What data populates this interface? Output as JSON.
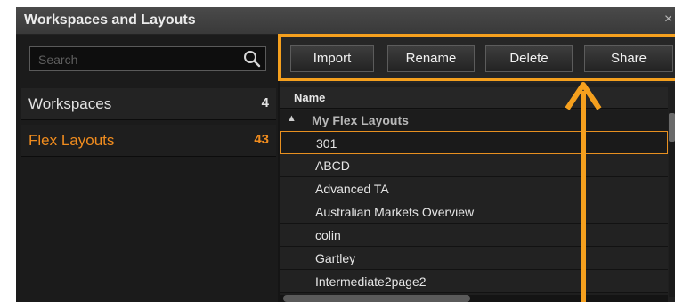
{
  "window": {
    "title": "Workspaces and Layouts",
    "close_glyph": "×"
  },
  "search": {
    "placeholder": "Search",
    "icon": "search-icon"
  },
  "sidebar": {
    "items": [
      {
        "label": "Workspaces",
        "count": "4",
        "active": false
      },
      {
        "label": "Flex Layouts",
        "count": "43",
        "active": true
      }
    ]
  },
  "toolbar": {
    "import_label": "Import",
    "rename_label": "Rename",
    "delete_label": "Delete",
    "share_label": "Share"
  },
  "list": {
    "column_header": "Name",
    "group_label": "My Flex Layouts",
    "group_toggle": "▲",
    "rows": [
      "301",
      "ABCD",
      "Advanced TA",
      "Australian Markets Overview",
      "colin",
      "Gartley",
      "Intermediate2page2"
    ],
    "selected_row": "301"
  },
  "colors": {
    "accent": "#f08c1e",
    "annotation": "#f5a01e",
    "background": "#151515"
  }
}
